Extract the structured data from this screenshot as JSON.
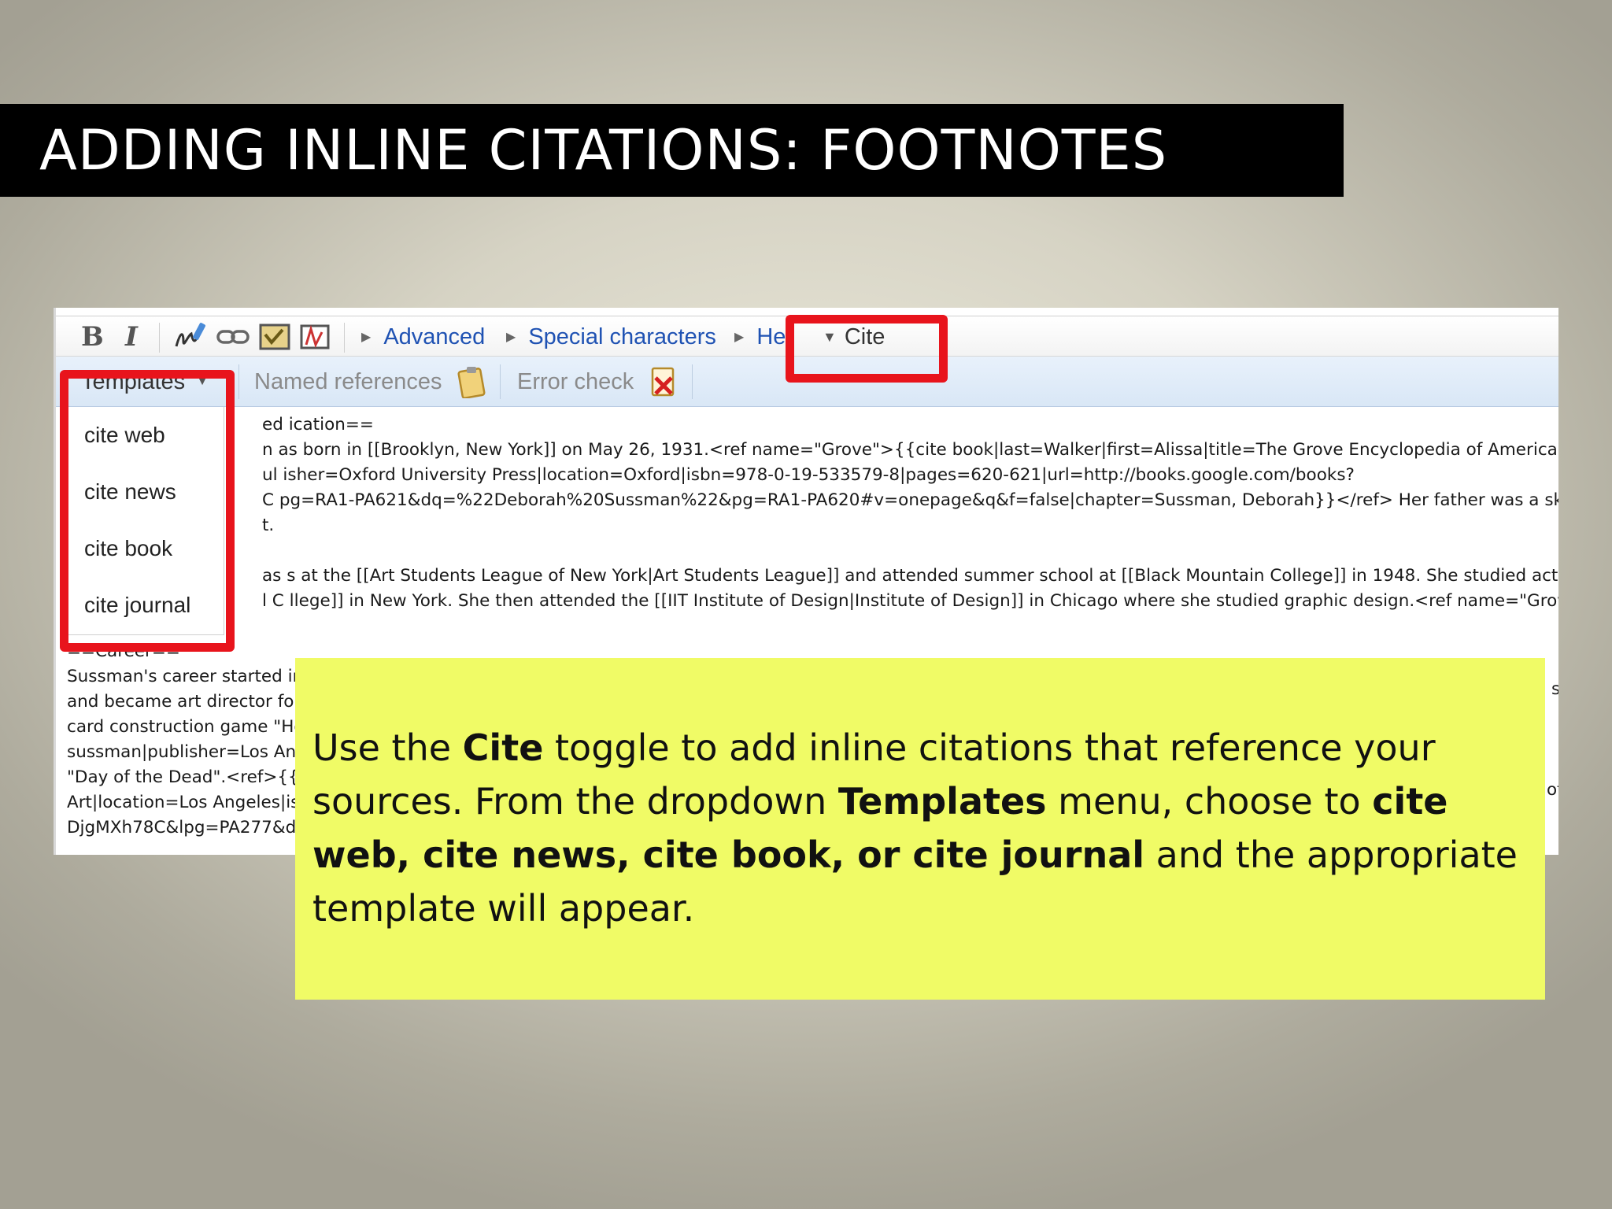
{
  "slide": {
    "title": "ADDING INLINE CITATIONS: FOOTNOTES"
  },
  "toolbar": {
    "bold_label": "B",
    "italic_label": "I",
    "advanced_label": "Advanced",
    "special_characters_label": "Special characters",
    "help_label": "Hel",
    "cite_label": "Cite"
  },
  "cite_toolbar": {
    "templates_label": "Templates",
    "named_references_label": "Named references",
    "error_check_label": "Error check"
  },
  "templates_menu": {
    "items": [
      "cite web",
      "cite news",
      "cite book",
      "cite journal"
    ]
  },
  "editor": {
    "right_lines": [
      "ed ication==",
      "n  as born in [[Brooklyn, New York]] on May 26, 1931.<ref name=\"Grove\">{{cite book|last=Walker|first=Alissa|title=The Grove Encyclopedia of American",
      "ul  isher=Oxford University Press|location=Oxford|isbn=978-0-19-533579-8|pages=620-621|url=http://books.google.com/books?",
      "C  pg=RA1-PA621&dq=%22Deborah%20Sussman%22&pg=RA1-PA620#v=onepage&q&f=false|chapter=Sussman, Deborah}}</ref> Her father was a skilled",
      "t.",
      "as  s at the [[Art Students League of New York|Art Students League]] and attended summer school at [[Black Mountain College]] in 1948. She studied acting and",
      "l C  llege]] in New York. She then attended the [[IIT Institute of Design|Institute of Design]] in Chicago where she studied graphic design.<ref name=\"Grove\"/>"
    ],
    "left_lines": [
      "==Career==",
      "Sussman's career started in",
      "and became art director for",
      "card construction game \"Ho",
      "sussman|publisher=Los An",
      "\"Day of the Dead\".<ref>{{ci",
      "Art|location=Los Angeles|is",
      "DjgMXh78C&lpg=PA277&d"
    ],
    "edge_right_1": "s",
    "edge_right_2": "of"
  },
  "note": {
    "p1": "Use the ",
    "b1": "Cite",
    "p2": " toggle to add inline citations that reference your sources. From the dropdown ",
    "b2": "Templates",
    "p3": " menu, choose to ",
    "b3": "cite web, cite news, cite book, or cite journal",
    "p4": " and the appropriate template will appear."
  },
  "colors": {
    "highlight_red": "#e8141c",
    "note_yellow": "#f0fb66",
    "link_blue": "#1f52b3",
    "title_bar": "#000000"
  },
  "icons": [
    "link-icon",
    "signature-icon",
    "image-icon",
    "gallery-icon",
    "reference-icon",
    "clipboard-icon",
    "error-check-icon"
  ]
}
